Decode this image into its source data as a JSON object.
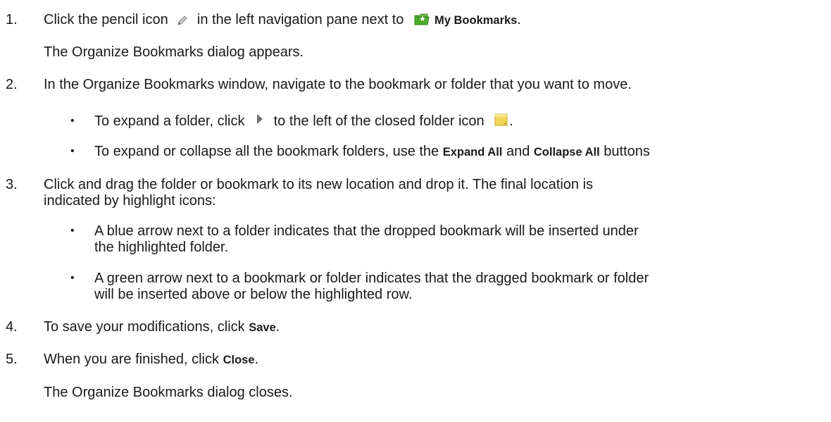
{
  "steps": [
    {
      "num": "1.",
      "parts": [
        "Click the pencil icon",
        "in the left navigation pane next to",
        "My Bookmarks",
        "."
      ]
    },
    {
      "text": "The Organize Bookmarks dialog appears."
    },
    {
      "num": "2.",
      "text": "In the Organize Bookmarks window, navigate to the bookmark or folder that you want to move."
    },
    {
      "bullets": [
        {
          "parts": [
            "To expand a folder, click",
            "to the left of the closed folder icon",
            "."
          ]
        },
        {
          "parts": [
            "To expand or collapse all the bookmark folders, use the",
            "Expand All",
            "and",
            "Collapse All",
            "buttons"
          ]
        }
      ]
    },
    {
      "num": "3.",
      "lines": [
        "Click and drag the folder or bookmark to its new location and drop it. The final location is",
        "indicated by highlight icons:"
      ]
    },
    {
      "bullets": [
        {
          "lines": [
            "A blue arrow next to a folder indicates that the dropped bookmark will be inserted under",
            "the highlighted folder."
          ]
        },
        {
          "lines": [
            "A green arrow next to a bookmark or folder indicates that the dragged bookmark or folder",
            "will be inserted above or below the highlighted row."
          ]
        }
      ]
    },
    {
      "num": "4.",
      "parts": [
        "To save your modifications, click",
        "Save",
        "."
      ]
    },
    {
      "num": "5.",
      "parts": [
        "When you are finished, click",
        "Close",
        "."
      ]
    },
    {
      "text": "The Organize Bookmarks dialog closes."
    }
  ],
  "bullet_glyph": "•",
  "icons": {
    "pencil": "pencil-icon",
    "bookmarks": "bookmark-star-icon",
    "expand_arrow": "expand-arrow-icon",
    "closed_folder": "closed-folder-icon"
  },
  "colors": {
    "text": "#1a1a1a",
    "bookmark_green": "#4caf2a",
    "folder_yellow": "#f2d65a",
    "pencil_gray": "#9a9a9a"
  }
}
